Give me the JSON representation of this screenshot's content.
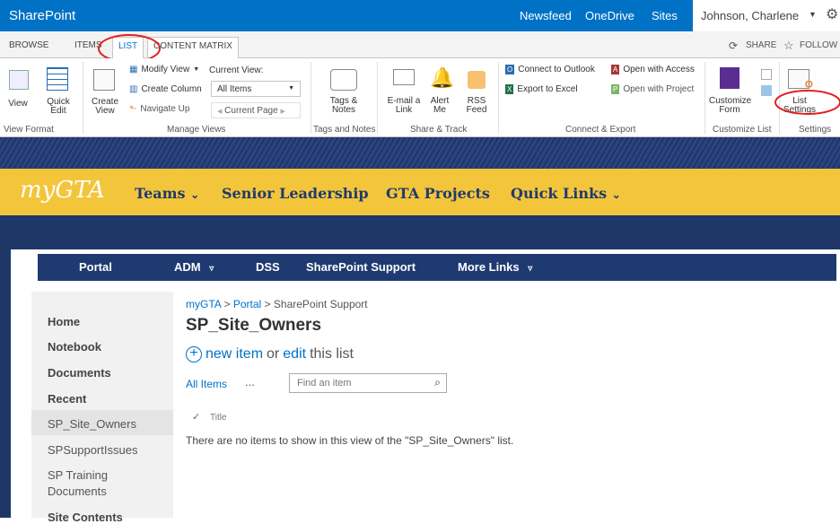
{
  "suite": {
    "brand": "SharePoint",
    "links": [
      "Newsfeed",
      "OneDrive",
      "Sites"
    ],
    "user": "Johnson, Charlene"
  },
  "ribbon_tabs": [
    "BROWSE",
    "ITEMS",
    "LIST",
    "CONTENT MATRIX"
  ],
  "share_label": "SHARE",
  "follow_label": "FOLLOW",
  "ribbon": {
    "view": "View",
    "quick_edit": "Quick Edit",
    "create_view": "Create View",
    "modify_view": "Modify View",
    "create_column": "Create Column",
    "navigate_up": "Navigate Up",
    "current_view_label": "Current View:",
    "current_view_value": "All Items",
    "current_page": "Current Page",
    "tags_notes": "Tags & Notes",
    "email_link": "E-mail a Link",
    "alert_me": "Alert Me",
    "rss_feed": "RSS Feed",
    "connect_outlook": "Connect to Outlook",
    "export_excel": "Export to Excel",
    "open_access": "Open with Access",
    "open_project": "Open with Project",
    "customize_form": "Customize Form",
    "list_settings": "List Settings",
    "groups": [
      "View Format",
      "Manage Views",
      "Tags and Notes",
      "Share & Track",
      "Connect & Export",
      "Customize List",
      "Settings"
    ]
  },
  "site": {
    "logo": "myGTA",
    "nav": [
      "Teams",
      "Senior Leadership",
      "GTA Projects",
      "Quick Links"
    ],
    "topnav": [
      "Portal",
      "ADM",
      "DSS",
      "SharePoint Support",
      "More Links"
    ]
  },
  "leftnav": {
    "home": "Home",
    "notebook": "Notebook",
    "documents": "Documents",
    "recent": "Recent",
    "recent_items": [
      "SP_Site_Owners",
      "SPSupportIssues",
      "SP Training Documents"
    ],
    "site_contents": "Site Contents"
  },
  "main": {
    "breadcrumb": [
      "myGTA",
      "Portal",
      "SharePoint Support"
    ],
    "breadcrumb_sep": ">",
    "title": "SP_Site_Owners",
    "new_item": "new item",
    "or": "or",
    "edit": "edit",
    "this_list": "this list",
    "all_items": "All Items",
    "ellipsis": "...",
    "search_placeholder": "Find an item",
    "col_title": "Title",
    "empty_msg": "There are no items to show in this view of the \"SP_Site_Owners\" list."
  },
  "colors": {
    "suite_blue": "#0072c6",
    "gold": "#f3c53a",
    "navy": "#1f3a70",
    "highlight": "#e02020"
  }
}
